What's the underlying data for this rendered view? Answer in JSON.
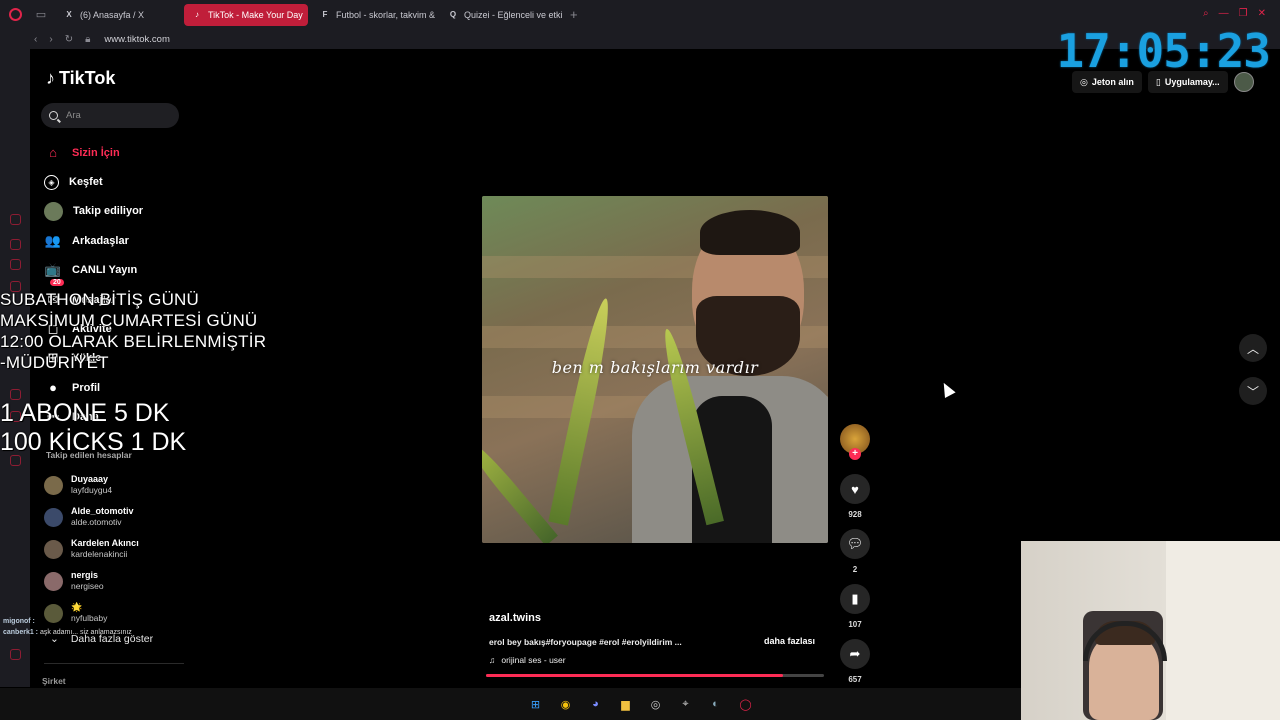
{
  "browser": {
    "tabs": [
      {
        "label": "(6) Anasayfa / X",
        "active": false,
        "fav": "X"
      },
      {
        "label": "TikTok - Make Your Day",
        "active": true,
        "fav": "♪"
      },
      {
        "label": "Futbol - skorlar, takvim &",
        "active": false,
        "fav": "F"
      },
      {
        "label": "Quizei - Eğlenceli ve etki",
        "active": false,
        "fav": "Q"
      }
    ],
    "new_tab": "+",
    "url": "www.tiktok.com"
  },
  "tiktok": {
    "logo_text": "TikTok",
    "search_placeholder": "Ara",
    "nav": [
      {
        "label": "Sizin İçin",
        "icon": "home-icon",
        "glyph": "⌂",
        "active": true
      },
      {
        "label": "Keşfet",
        "icon": "compass-icon",
        "glyph": "◈",
        "active": false
      },
      {
        "label": "Takip ediliyor",
        "icon": "following-avatar-icon",
        "glyph": "",
        "active": false
      },
      {
        "label": "Arkadaşlar",
        "icon": "friends-icon",
        "glyph": "👥",
        "active": false
      },
      {
        "label": "CANLI Yayın",
        "icon": "live-icon",
        "glyph": "📺",
        "active": false
      },
      {
        "label": "Mesajlar",
        "icon": "messages-icon",
        "glyph": "✉",
        "active": false,
        "badge": "20"
      },
      {
        "label": "Aktivite",
        "icon": "activity-icon",
        "glyph": "◻",
        "active": false
      },
      {
        "label": "Yükle",
        "icon": "upload-icon",
        "glyph": "⊞",
        "active": false
      },
      {
        "label": "Profil",
        "icon": "profile-icon",
        "glyph": "●",
        "active": false
      },
      {
        "label": "Daha",
        "icon": "more-icon",
        "glyph": "⋯",
        "active": false
      }
    ],
    "following_title": "Takip edilen hesaplar",
    "following": [
      {
        "name": "Duyaaay",
        "user": "layfduygu4",
        "color": "#7a6a4a"
      },
      {
        "name": "Alde_otomotiv",
        "user": "alde.otomotiv",
        "color": "#3b4a6a"
      },
      {
        "name": "Kardelen Akıncı",
        "user": "kardelenakincii",
        "color": "#6a5a4a"
      },
      {
        "name": "nergis",
        "user": "nergiseo",
        "color": "#8a6a6a"
      },
      {
        "name": "🌟",
        "user": "nyfulbaby",
        "color": "#5a5a3a"
      }
    ],
    "show_more": "Daha fazla göster",
    "company": "Şirket"
  },
  "overlay": {
    "announcement": [
      "SUBATHON BİTİŞ GÜNÜ",
      "MAKSİMUM CUMARTESİ GÜNÜ",
      "12:00 OLARAK BELİRLENMİŞTİR",
      "-MÜDÜRİYET"
    ],
    "rates": [
      "1 ABONE 5 DK",
      "100 KİCKS  1 DK"
    ],
    "chat": [
      {
        "user": "migonof :",
        "text": ""
      },
      {
        "user": "canberk1 :",
        "text": "aşk adamı... siz anlamazsınız"
      }
    ]
  },
  "clock": "17:05:23",
  "top_actions": {
    "coins": "Jeton alın",
    "app": "Uygulamay..."
  },
  "video": {
    "overlay_text": "ben m bakışlarım vardır",
    "author": "azal.twins",
    "description": "erol bey bakış#foryoupage #erol #erolyildirim ...",
    "more": "daha fazlası",
    "music": "orijinal ses - user",
    "progress": 0.88,
    "likes": "928",
    "comments": "2",
    "saves": "107",
    "shares": "657"
  },
  "colors": {
    "accent": "#fe2c55",
    "clock": "#1aa0e0"
  }
}
